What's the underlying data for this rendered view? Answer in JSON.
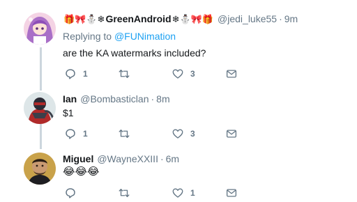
{
  "tweets": [
    {
      "name": "GreenAndroid",
      "name_prefix_emoji": "🎁🎀⛄❄",
      "name_suffix_emoji": "❄⛄🎀🎁",
      "handle": "@jedi_luke55",
      "separator": "·",
      "time": "9m",
      "replying_label": "Replying to ",
      "replying_to": "@FUNimation",
      "text": "are the KA watermarks included?",
      "reply_count": "1",
      "retweet_count": "",
      "like_count": "3"
    },
    {
      "name": "Ian",
      "handle": "@Bombasticlan",
      "separator": "·",
      "time": "8m",
      "text": "$1",
      "reply_count": "1",
      "retweet_count": "",
      "like_count": "3"
    },
    {
      "name": "Miguel",
      "handle": "@WayneXXIII",
      "separator": "·",
      "time": "6m",
      "text": "😂😂😂",
      "reply_count": "",
      "retweet_count": "",
      "like_count": "1"
    }
  ],
  "icons": {
    "reply": "reply-icon",
    "retweet": "retweet-icon",
    "like": "heart-icon",
    "dm": "envelope-icon"
  },
  "colors": {
    "link": "#1da1f2",
    "secondary_text": "#657786",
    "thread_line": "#ccd6dd"
  }
}
